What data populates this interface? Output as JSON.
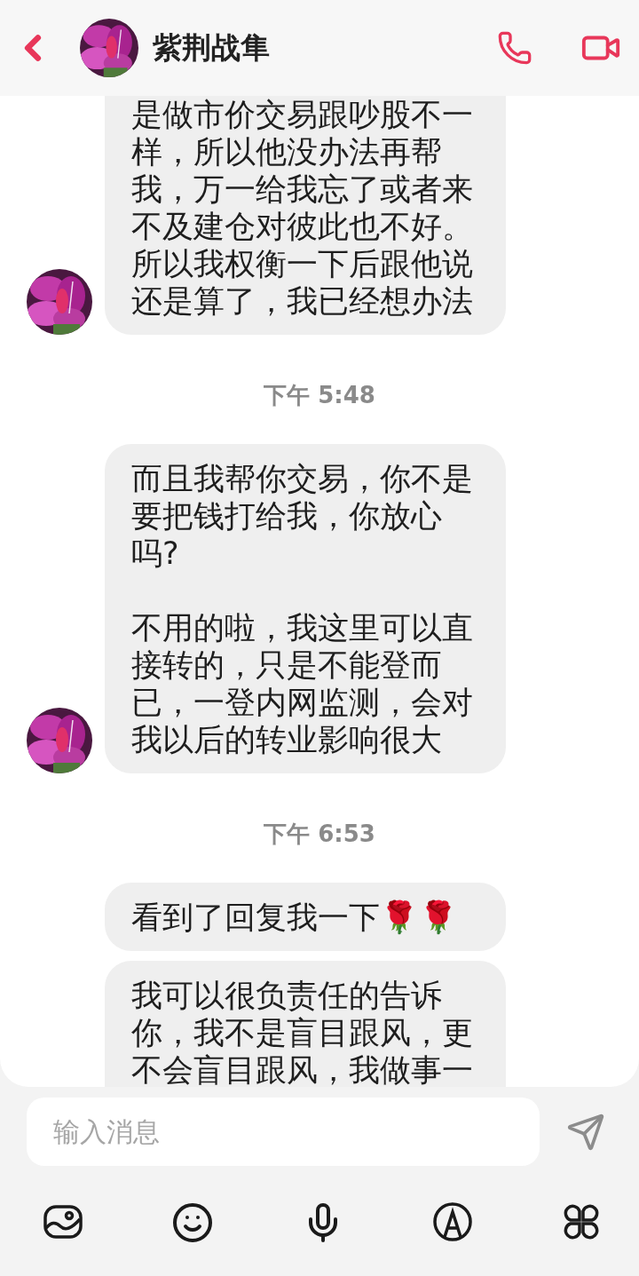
{
  "header": {
    "contact_name": "紫荆战隼"
  },
  "messages": [
    {
      "kind": "text",
      "text": "是做市价交易跟吵股不一样，所以他没办法再帮我，万一给我忘了或者来不及建仓对彼此也不好。所以我权衡一下后跟他说还是算了，我已经想办法",
      "avatar": true,
      "cut_top": true,
      "cut_bottom": false
    },
    {
      "kind": "time",
      "text": "下午 5:48"
    },
    {
      "kind": "text",
      "text": "而且我帮你交易，你不是要把钱打给我，你放心吗?\n\n不用的啦，我这里可以直接转的，只是不能登而已，一登内网监测，会对我以后的转业影响很大",
      "avatar": true,
      "cut_top": false,
      "cut_bottom": false
    },
    {
      "kind": "time",
      "text": "下午 6:53"
    },
    {
      "kind": "text",
      "text": "看到了回复我一下🌹🌹",
      "avatar": false,
      "cut_top": false,
      "cut_bottom": false
    },
    {
      "kind": "text",
      "text": "我可以很负责任的告诉你，我不是盲目跟风，更不会盲目跟风，我做事一",
      "avatar": false,
      "cut_top": false,
      "cut_bottom": true
    }
  ],
  "composer": {
    "placeholder": "输入消息"
  }
}
